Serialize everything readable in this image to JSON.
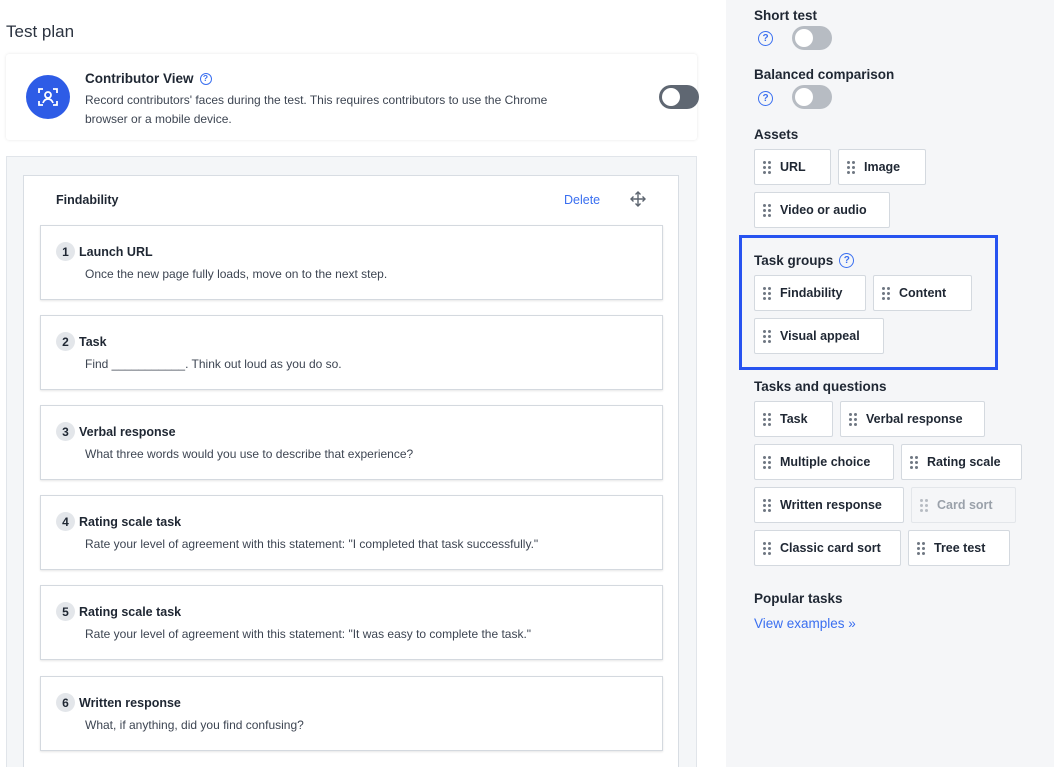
{
  "main": {
    "title": "Test plan",
    "contributor_view": {
      "title": "Contributor View",
      "description": "Record contributors' faces during the test. This requires contributors to use the Chrome browser or a mobile device.",
      "enabled": true
    },
    "task_group": {
      "name": "Findability",
      "delete_label": "Delete",
      "steps": [
        {
          "number": "1",
          "title": "Launch URL",
          "desc": "Once the new page fully loads, move on to the next step."
        },
        {
          "number": "2",
          "title": "Task",
          "desc": "Find ___________. Think out loud as you do so."
        },
        {
          "number": "3",
          "title": "Verbal response",
          "desc": "What three words would you use to describe that experience?"
        },
        {
          "number": "4",
          "title": "Rating scale task",
          "desc": "Rate your level of agreement with this statement: \"I completed that task successfully.\""
        },
        {
          "number": "5",
          "title": "Rating scale task",
          "desc": "Rate your level of agreement with this statement: \"It was easy to complete the task.\""
        },
        {
          "number": "6",
          "title": "Written response",
          "desc": "What, if anything, did you find confusing?"
        }
      ]
    }
  },
  "sidebar": {
    "short_test": {
      "label": "Short test",
      "enabled": false
    },
    "balanced_comparison": {
      "label": "Balanced comparison",
      "enabled": false
    },
    "assets": {
      "label": "Assets",
      "items": [
        "URL",
        "Image",
        "Video or audio"
      ]
    },
    "task_groups": {
      "label": "Task groups",
      "items": [
        "Findability",
        "Content",
        "Visual appeal"
      ]
    },
    "tasks_and_questions": {
      "label": "Tasks and questions",
      "items": [
        "Task",
        "Verbal response",
        "Multiple choice",
        "Rating scale",
        "Written response",
        "Card sort",
        "Classic card sort",
        "Tree test"
      ]
    },
    "popular_tasks": {
      "label": "Popular tasks",
      "link": "View examples »"
    }
  },
  "colors": {
    "accent": "#3a6ff0",
    "avatar": "#2e5ce6",
    "highlight": "#2753f0",
    "toggle_on": "#5f6772",
    "toggle_off": "#b7bcc3"
  }
}
